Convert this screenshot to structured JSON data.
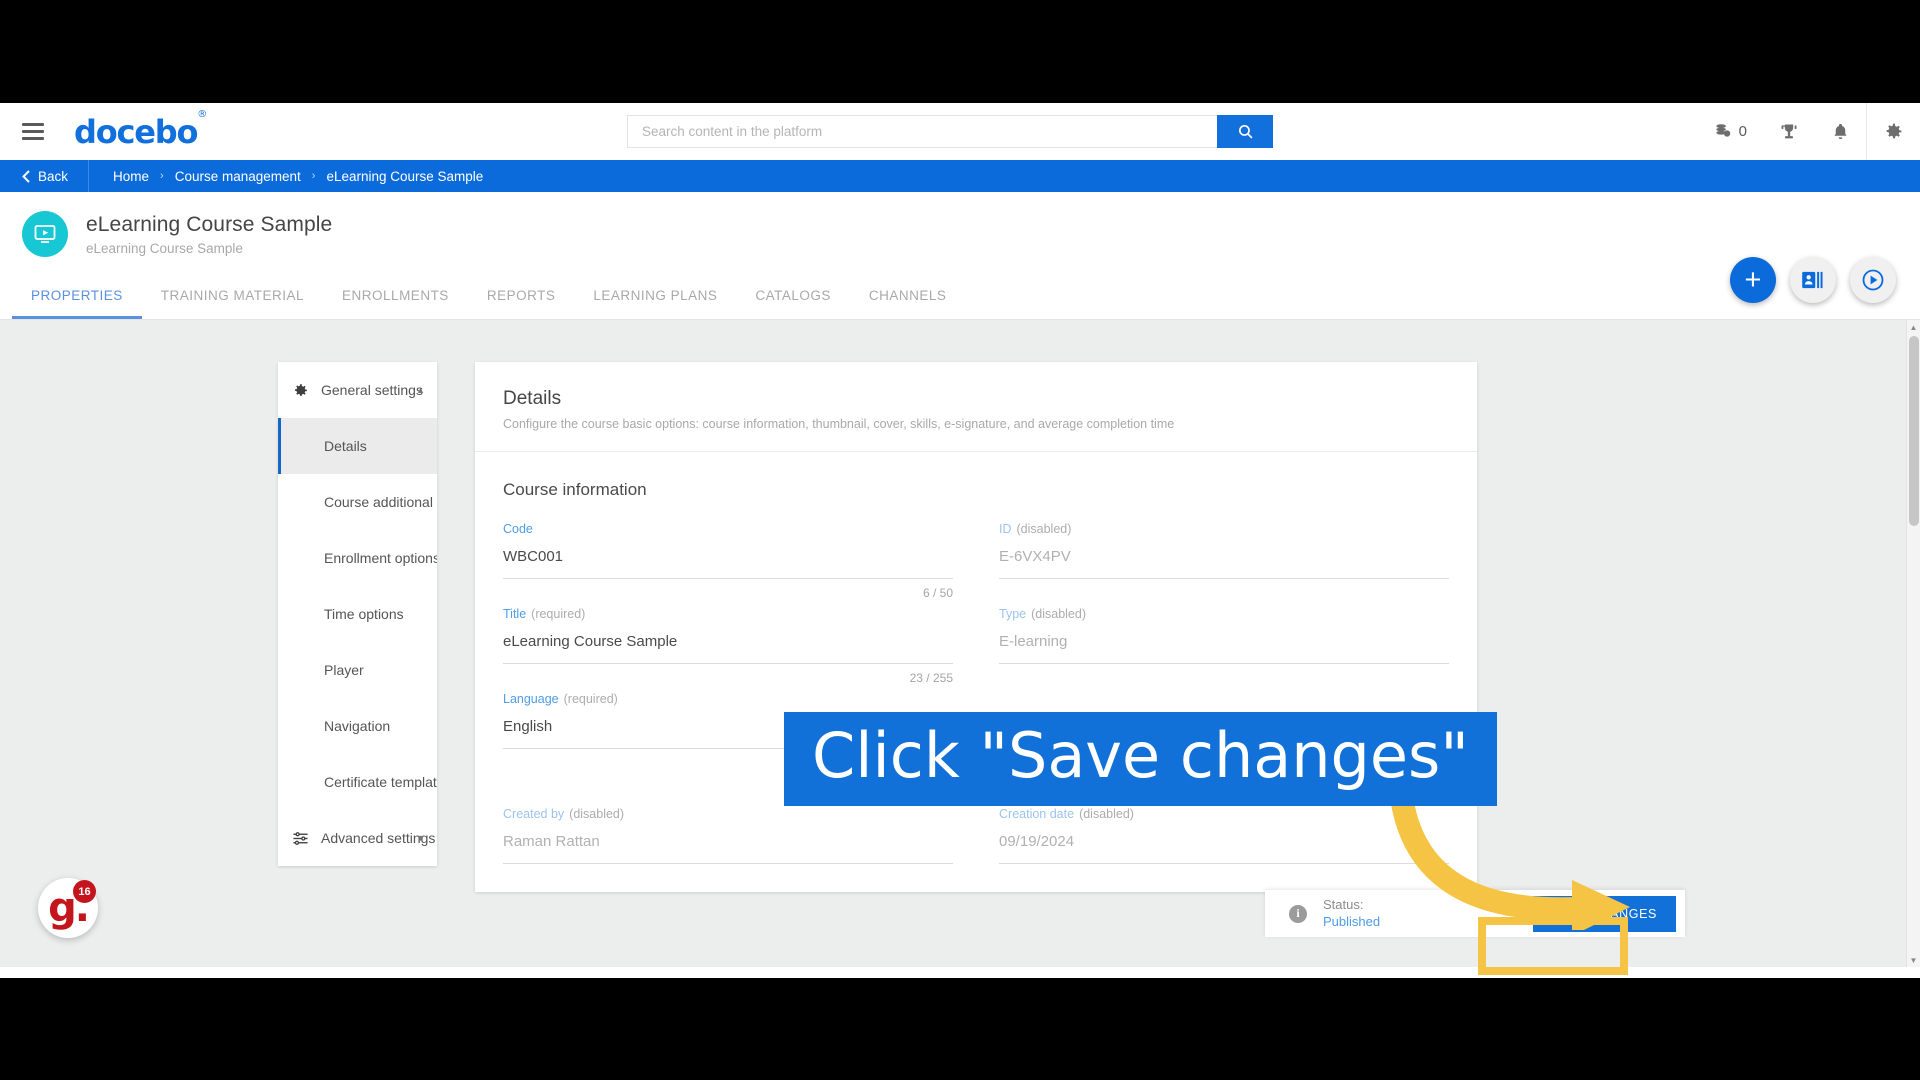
{
  "header": {
    "menu_icon": "hamburger-icon",
    "logo_text": "docebo",
    "logo_trademark": "®",
    "search_placeholder": "Search content in the platform",
    "search_value": "",
    "search_icon": "search-icon",
    "coins_icon": "coins-icon",
    "coins_count": "0",
    "trophy_icon": "trophy-icon",
    "bell_icon": "bell-icon",
    "gear_icon": "gear-icon"
  },
  "breadcrumb": {
    "back_label": "Back",
    "back_icon": "chevron-left-icon",
    "items": [
      {
        "label": "Home"
      },
      {
        "label": "Course management"
      },
      {
        "label": "eLearning Course Sample"
      }
    ],
    "separator": "›"
  },
  "fabs": [
    {
      "name": "add-button",
      "glyph": "+"
    },
    {
      "name": "enroll-users-button",
      "glyph": "id-card-icon"
    },
    {
      "name": "play-course-button",
      "glyph": "play-circle-icon"
    }
  ],
  "page": {
    "avatar_icon": "elearning-course-icon",
    "title": "eLearning Course Sample",
    "subtitle": "eLearning Course Sample"
  },
  "tabs": [
    {
      "label": "PROPERTIES",
      "active": true
    },
    {
      "label": "TRAINING MATERIAL",
      "active": false
    },
    {
      "label": "ENROLLMENTS",
      "active": false
    },
    {
      "label": "REPORTS",
      "active": false
    },
    {
      "label": "LEARNING PLANS",
      "active": false
    },
    {
      "label": "CATALOGS",
      "active": false
    },
    {
      "label": "CHANNELS",
      "active": false
    }
  ],
  "settings_menu": {
    "general": {
      "label": "General settings",
      "icon": "gear-icon",
      "caret": "▲",
      "items": [
        {
          "label": "Details",
          "selected": true
        },
        {
          "label": "Course additional fields",
          "selected": false
        },
        {
          "label": "Enrollment options",
          "selected": false
        },
        {
          "label": "Time options",
          "selected": false
        },
        {
          "label": "Player",
          "selected": false
        },
        {
          "label": "Navigation",
          "selected": false
        },
        {
          "label": "Certificate templates",
          "selected": false
        }
      ]
    },
    "advanced": {
      "label": "Advanced settings",
      "icon": "sliders-icon",
      "caret": "▼"
    }
  },
  "details": {
    "heading": "Details",
    "description": "Configure the course basic options: course information, thumbnail, cover, skills, e-signature, and average completion time",
    "section_title": "Course information",
    "fields": {
      "code": {
        "label": "Code",
        "hint": "",
        "value": "WBC001",
        "counter": "6 / 50",
        "disabled": false
      },
      "id": {
        "label": "ID",
        "hint": "(disabled)",
        "value": "E-6VX4PV",
        "counter": "",
        "disabled": true
      },
      "title": {
        "label": "Title",
        "hint": "(required)",
        "value": "eLearning Course Sample",
        "counter": "23 / 255",
        "disabled": false
      },
      "type": {
        "label": "Type",
        "hint": "(disabled)",
        "value": "E-learning",
        "counter": "",
        "disabled": true
      },
      "language": {
        "label": "Language",
        "hint": "(required)",
        "value": "English",
        "counter": "",
        "disabled": false
      },
      "created_by": {
        "label": "Created by",
        "hint": "(disabled)",
        "value": "Raman Rattan",
        "counter": "",
        "disabled": true
      },
      "creation_date": {
        "label": "Creation date",
        "hint": "(disabled)",
        "value": "09/19/2024",
        "counter": "",
        "disabled": true
      }
    }
  },
  "statusbar": {
    "info_icon": "info-icon",
    "status_label": "Status:",
    "status_value": "Published",
    "save_label": "SAVE CHANGES"
  },
  "overlay": {
    "callout_text": "Click \"Save changes\"",
    "callout_bg": "#1271d8",
    "highlight_color": "#f6c445",
    "arrow_color": "#f6c445"
  },
  "watermark": {
    "logo_text": "g.",
    "badge": "16"
  }
}
